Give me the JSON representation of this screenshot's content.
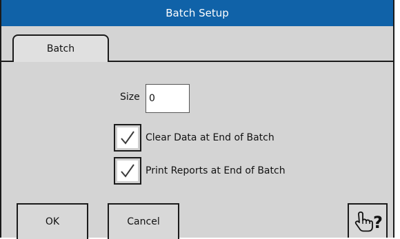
{
  "window": {
    "title": "Batch Setup"
  },
  "tabs": [
    {
      "label": "Batch",
      "active": true
    }
  ],
  "size": {
    "label": "Size",
    "value": "0"
  },
  "options": [
    {
      "label": "Clear Data at End of Batch",
      "checked": true
    },
    {
      "label": "Print Reports at End of Batch",
      "checked": true
    }
  ],
  "buttons": {
    "ok": "OK",
    "cancel": "Cancel",
    "help_icon": "hand-pointer-question-icon"
  },
  "colors": {
    "titlebar": "#1062a8",
    "dialog_bg": "#d4d4d4",
    "border": "#1a1a1a"
  }
}
